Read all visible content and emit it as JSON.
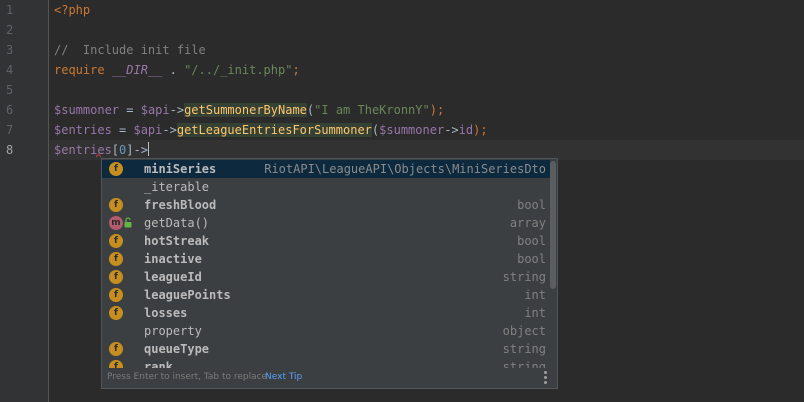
{
  "editor": {
    "line_numbers": [
      "1",
      "2",
      "3",
      "4",
      "5",
      "6",
      "7",
      "8"
    ],
    "lines": {
      "l1": {
        "php_open": "<?php"
      },
      "l3": {
        "comment": "//  Include init file"
      },
      "l4": {
        "kw": "require",
        "const": "__DIR__",
        "dot": " . ",
        "str": "\"/../_init.php\"",
        "end": ";"
      },
      "l6": {
        "var1": "$summoner",
        "eq": " = ",
        "var2": "$api",
        "arrow": "->",
        "fn": "getSummonerByName",
        "open": "(",
        "str": "\"I am TheKronnY\"",
        "close": ");"
      },
      "l7": {
        "var1": "$entries",
        "eq": " = ",
        "var2": "$api",
        "arrow": "->",
        "fn": "getLeagueEntriesForSummoner",
        "open": "(",
        "var3": "$summoner",
        "arrow2": "->",
        "prop": "id",
        "close": ");"
      },
      "l8": {
        "var": "$entries",
        "open": "[",
        "num": "0",
        "close": "]",
        "arrow": "->"
      }
    }
  },
  "completion": {
    "items": [
      {
        "icon": "f",
        "name": "miniSeries",
        "type": "RiotAPI\\LeagueAPI\\Objects\\MiniSeriesDto",
        "bold": true
      },
      {
        "icon": "",
        "name": "_iterable",
        "type": "",
        "bold": false
      },
      {
        "icon": "f",
        "name": "freshBlood",
        "type": "bool",
        "bold": true
      },
      {
        "icon": "m",
        "name": "getData()",
        "type": "array",
        "bold": false
      },
      {
        "icon": "f",
        "name": "hotStreak",
        "type": "bool",
        "bold": true
      },
      {
        "icon": "f",
        "name": "inactive",
        "type": "bool",
        "bold": true
      },
      {
        "icon": "f",
        "name": "leagueId",
        "type": "string",
        "bold": true
      },
      {
        "icon": "f",
        "name": "leaguePoints",
        "type": "int",
        "bold": true
      },
      {
        "icon": "f",
        "name": "losses",
        "type": "int",
        "bold": true
      },
      {
        "icon": "",
        "name": "property",
        "type": "object",
        "bold": false
      },
      {
        "icon": "f",
        "name": "queueType",
        "type": "string",
        "bold": true
      },
      {
        "icon": "f",
        "name": "rank",
        "type": "string",
        "bold": true
      }
    ],
    "footer_hint": "Press Enter to insert, Tab to replace",
    "footer_tip": "Next Tip"
  },
  "colors": {
    "background": "#2b2b2b",
    "field_icon": "#c58e1f",
    "method_icon": "#b25b6f",
    "selection": "#0d293e",
    "link": "#589df6"
  }
}
